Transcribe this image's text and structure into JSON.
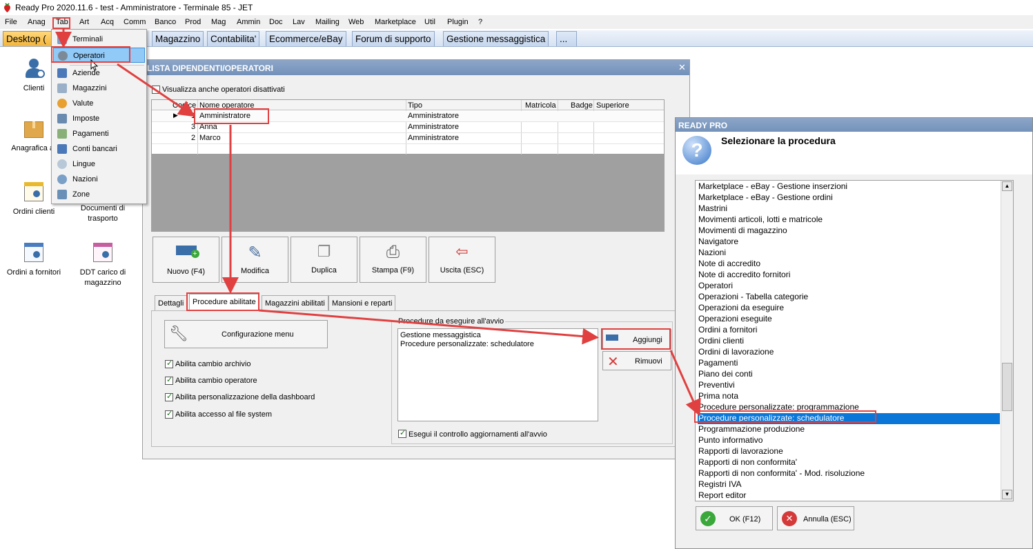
{
  "window": {
    "title": "Ready Pro 2020.11.6 - test - Amministratore - Terminale 85 - JET"
  },
  "menubar": [
    "File",
    "Anag",
    "Tab",
    "Art",
    "Acq",
    "Comm",
    "Banco",
    "Prod",
    "Mag",
    "Ammin",
    "Doc",
    "Lav",
    "Mailing",
    "Web",
    "Marketplace",
    "Util",
    "Plugin",
    "?"
  ],
  "tabs": {
    "desktop": "Desktop (",
    "t1": "Magazzino",
    "t2": "Contabilita'",
    "t3": "Ecommerce/eBay",
    "t4": "Forum di supporto",
    "t5": "Gestione messaggistica",
    "more": "..."
  },
  "desktop_icons": {
    "clienti": "Clienti",
    "anagrafica": "Anagrafica ar",
    "ordini_clienti": "Ordini clienti",
    "documenti": "Documenti di trasporto",
    "ordini_fornitori": "Ordini a fornitori",
    "ddt": "DDT carico di magazzino"
  },
  "tab_menu": [
    "Terminali",
    "Operatori",
    "Aziende",
    "Magazzini",
    "Valute",
    "Imposte",
    "Pagamenti",
    "Conti bancari",
    "Lingue",
    "Nazioni",
    "Zone"
  ],
  "main_window": {
    "title": "LISTA DIPENDENTI/OPERATORI",
    "show_disabled_label": "Visualizza anche operatori disattivati",
    "columns": {
      "codice": "Codice",
      "nome": "Nome operatore",
      "tipo": "Tipo",
      "matricola": "Matricola",
      "badge": "Badge",
      "superiore": "Superiore"
    },
    "rows": [
      {
        "codice": "1",
        "nome": "Amministratore",
        "tipo": "Amministratore"
      },
      {
        "codice": "3",
        "nome": "Anna",
        "tipo": "Amministratore"
      },
      {
        "codice": "2",
        "nome": "Marco",
        "tipo": "Amministratore"
      }
    ],
    "buttons": {
      "nuovo": "Nuovo (F4)",
      "modifica": "Modifica",
      "duplica": "Duplica",
      "stampa": "Stampa (F9)",
      "uscita": "Uscita (ESC)"
    },
    "subtabs": {
      "dettagli": "Dettagli",
      "procedure": "Procedure abilitate",
      "magazzini": "Magazzini abilitati",
      "mansioni": "Mansioni e reparti"
    },
    "config_menu": "Configurazione menu",
    "checkboxes": {
      "c1": "Abilita cambio archivio",
      "c2": "Abilita cambio operatore",
      "c3": "Abilita personalizzazione della dashboard",
      "c4": "Abilita accesso al file system"
    },
    "startup_group": "Procedure da eseguire all'avvio",
    "startup_items": {
      "i1": "Gestione messaggistica",
      "i2": "Procedure personalizzate: schedulatore"
    },
    "aggiungi": "Aggiungi",
    "rimuovi": "Rimuovi",
    "check_updates": "Esegui il controllo aggiornamenti all'avvio"
  },
  "dialog": {
    "title": "READY PRO",
    "question": "Selezionare la procedura",
    "items": [
      "Marketplace - eBay - Gestione inserzioni",
      "Marketplace - eBay - Gestione ordini",
      "Mastrini",
      "Movimenti articoli, lotti e matricole",
      "Movimenti di magazzino",
      "Navigatore",
      "Nazioni",
      "Note di accredito",
      "Note di accredito fornitori",
      "Operatori",
      "Operazioni - Tabella categorie",
      "Operazioni da eseguire",
      "Operazioni eseguite",
      "Ordini a fornitori",
      "Ordini clienti",
      "Ordini di lavorazione",
      "Pagamenti",
      "Piano dei conti",
      "Preventivi",
      "Prima nota",
      "Procedure personalizzate: programmazione",
      "Procedure personalizzate: schedulatore",
      "Programmazione produzione",
      "Punto informativo",
      "Rapporti di lavorazione",
      "Rapporti di non conformita'",
      "Rapporti di non conformita' - Mod. risoluzione",
      "Registri IVA",
      "Report editor"
    ],
    "selected": "Procedure personalizzate: schedulatore",
    "ok": "OK (F12)",
    "annulla": "Annulla (ESC)"
  },
  "colors": {
    "accent_red": "#e04040",
    "selection_blue": "#0a77d8",
    "header_blue": "#7c98c0",
    "active_tab": "#f3b43a"
  }
}
